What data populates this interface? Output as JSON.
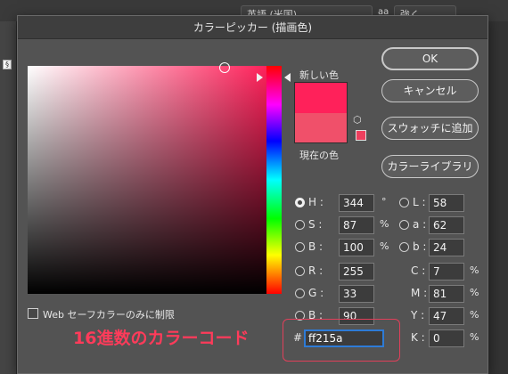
{
  "background": {
    "select1": "英語 (米国)",
    "symbol": "aa",
    "select2": "強く"
  },
  "dialog": {
    "title": "カラーピッカー (描画色)",
    "new_label": "新しい色",
    "current_label": "現在の色",
    "websafe_label": "Web セーフカラーのみに制限",
    "buttons": {
      "ok": "OK",
      "cancel": "キャンセル",
      "add_swatch": "スウォッチに追加",
      "library": "カラーライブラリ"
    },
    "hsb": [
      {
        "label": "H :",
        "value": "344",
        "unit": "°",
        "selected": true
      },
      {
        "label": "S :",
        "value": "87",
        "unit": "%",
        "selected": false
      },
      {
        "label": "B :",
        "value": "100",
        "unit": "%",
        "selected": false
      }
    ],
    "rgb": [
      {
        "label": "R :",
        "value": "255"
      },
      {
        "label": "G :",
        "value": "33"
      },
      {
        "label": "B :",
        "value": "90"
      }
    ],
    "lab": [
      {
        "label": "L :",
        "value": "58"
      },
      {
        "label": "a :",
        "value": "62"
      },
      {
        "label": "b :",
        "value": "24"
      }
    ],
    "cmyk": [
      {
        "label": "C :",
        "value": "7",
        "unit": "%"
      },
      {
        "label": "M :",
        "value": "81",
        "unit": "%"
      },
      {
        "label": "Y :",
        "value": "47",
        "unit": "%"
      },
      {
        "label": "K :",
        "value": "0",
        "unit": "%"
      }
    ],
    "hex_label": "#",
    "hex_value": "ff215a",
    "annotation": "16進数のカラーコード",
    "colors": {
      "new": "#ff215a",
      "current": "#f0506a",
      "annotation": "#ff3b5a"
    }
  }
}
